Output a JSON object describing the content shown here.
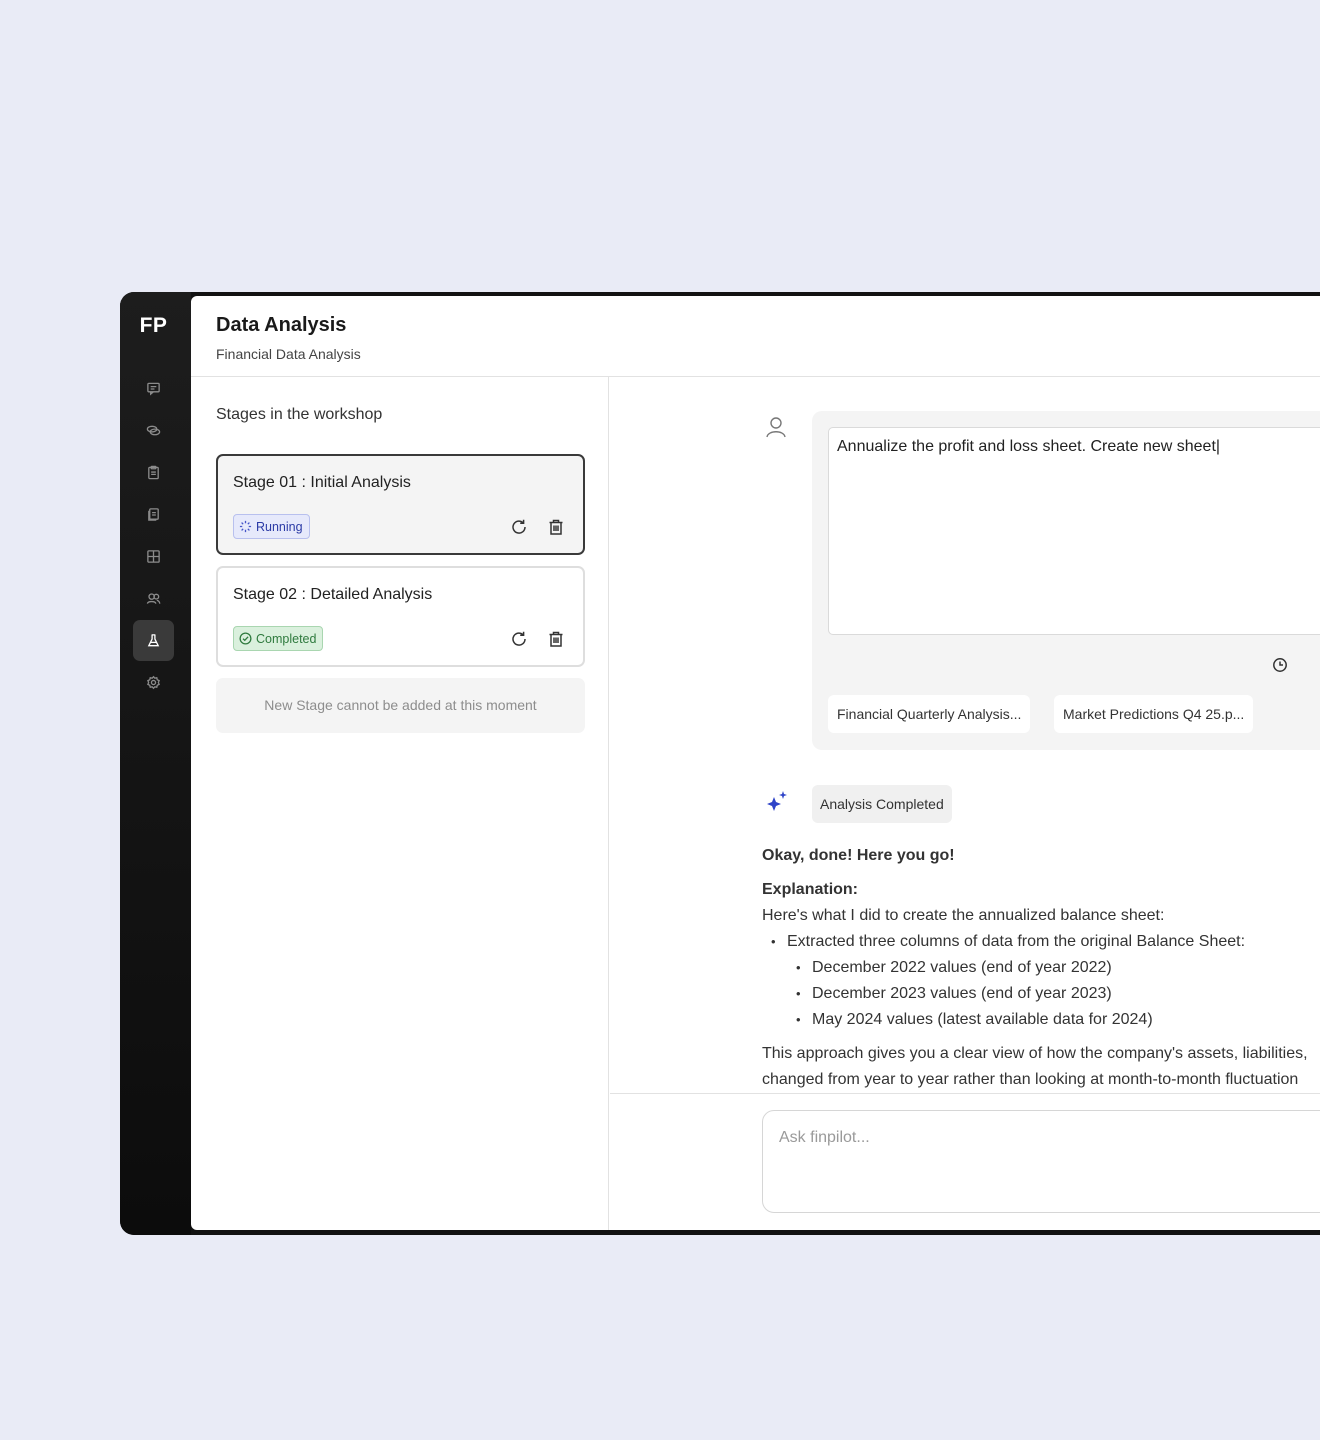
{
  "app": {
    "logo": "FP"
  },
  "header": {
    "title": "Data Analysis",
    "subtitle": "Financial Data Analysis"
  },
  "nav": [
    {
      "name": "chat",
      "active": false
    },
    {
      "name": "coins",
      "active": false
    },
    {
      "name": "clipboard",
      "active": false
    },
    {
      "name": "documents",
      "active": false
    },
    {
      "name": "table",
      "active": false
    },
    {
      "name": "users",
      "active": false
    },
    {
      "name": "flask",
      "active": true
    },
    {
      "name": "settings",
      "active": false
    }
  ],
  "stages": {
    "title": "Stages in the workshop",
    "items": [
      {
        "label": "Stage 01 : Initial Analysis",
        "status": "Running"
      },
      {
        "label": "Stage 02 : Detailed Analysis",
        "status": "Completed"
      }
    ],
    "notice": "New Stage cannot be added at this moment"
  },
  "chat": {
    "prompt": "Annualize the profit and loss sheet. Create new sheet|",
    "attachments": [
      "Financial Quarterly Analysis...",
      "Market Predictions Q4 25.p..."
    ],
    "status": "Analysis Completed",
    "response": {
      "lead": "Okay, done! Here you go!",
      "heading": "Explanation:",
      "intro": "Here's what I did to create the annualized balance sheet:",
      "bullet": "Extracted three columns of data from the original Balance Sheet:",
      "subbullets": [
        "December 2022 values (end of year 2022)",
        "December 2023 values (end of year 2023)",
        "May 2024 values (latest available data for 2024)"
      ],
      "para_line1": "This approach gives you a clear view of how the company's assets, liabilities,",
      "para_line2": "changed from year to year rather than looking at month-to-month fluctuation"
    },
    "input_placeholder": "Ask finpilot..."
  }
}
